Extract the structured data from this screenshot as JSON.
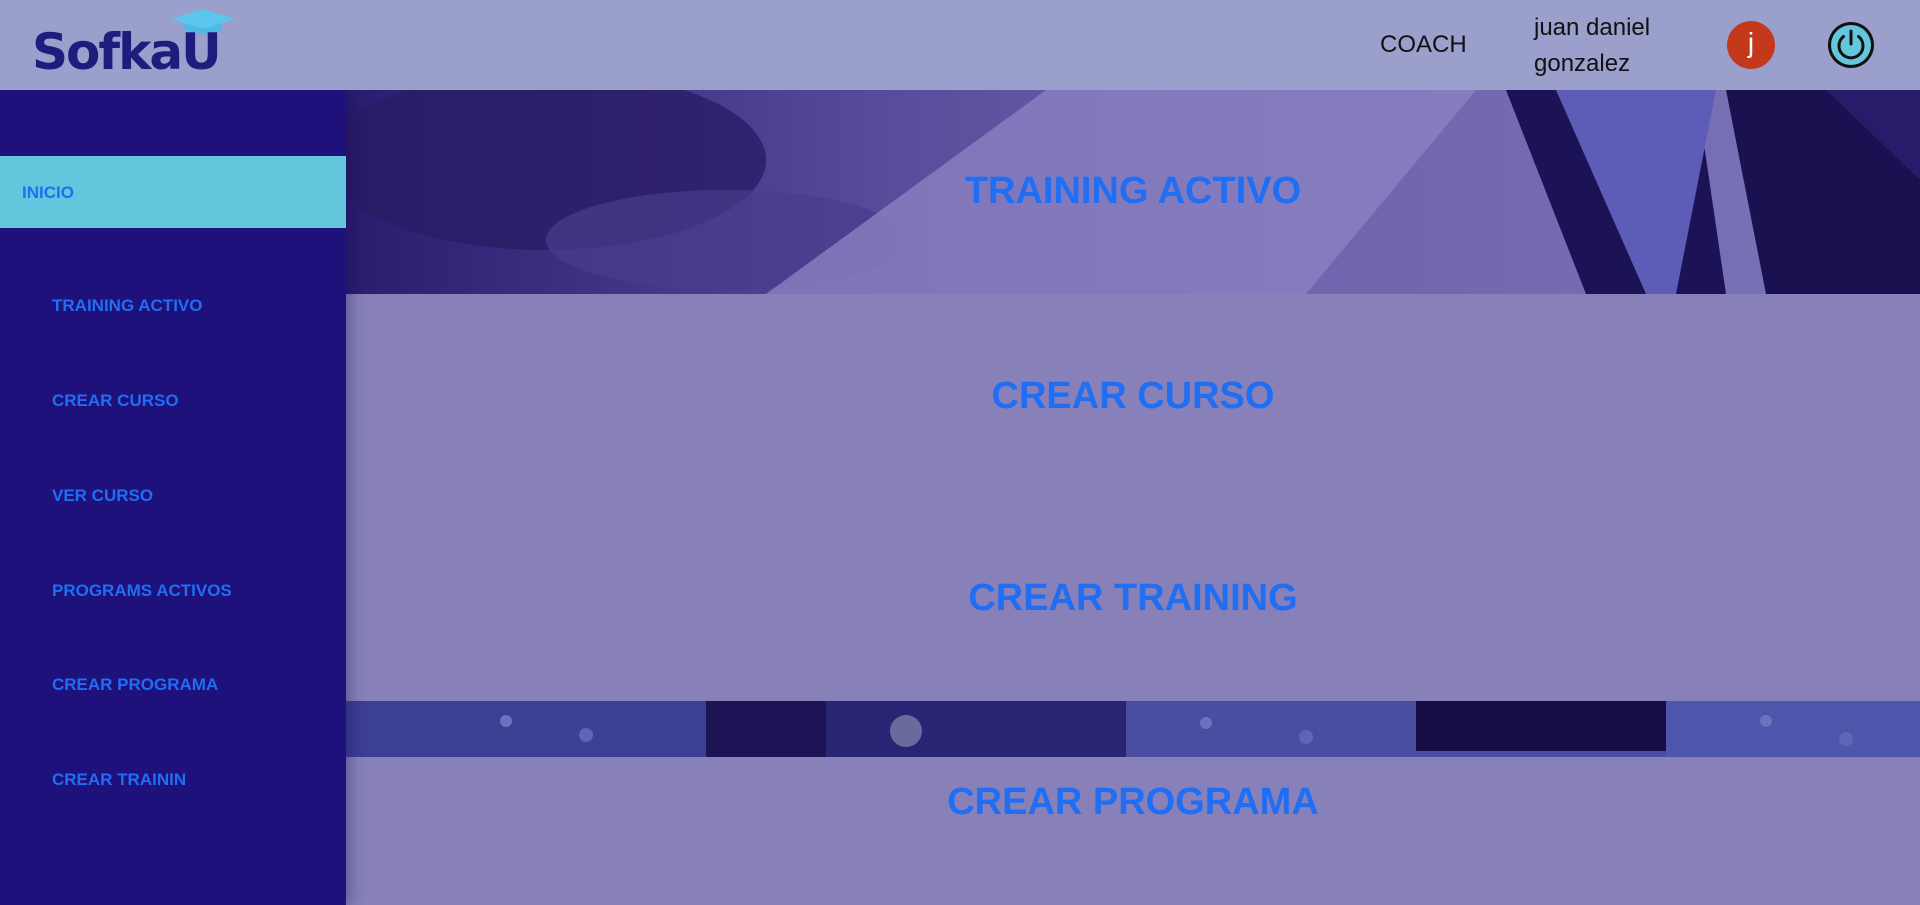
{
  "header": {
    "logo_text": "SofkaU",
    "role": "COACH",
    "user_name": "juan daniel gonzalez",
    "avatar_initial": "j"
  },
  "sidebar": {
    "active_item": "INICIO",
    "items": [
      {
        "label": "TRAINING ACTIVO"
      },
      {
        "label": "CREAR CURSO"
      },
      {
        "label": "VER CURSO"
      },
      {
        "label": "PROGRAMS ACTIVOS"
      },
      {
        "label": "CREAR PROGRAMA"
      },
      {
        "label": "CREAR TRAININ"
      }
    ]
  },
  "main": {
    "panels": [
      {
        "title": "TRAINING ACTIVO"
      },
      {
        "title": "CREAR CURSO"
      },
      {
        "title": "CREAR TRAINING"
      },
      {
        "title": "CREAR PROGRAMA"
      }
    ]
  },
  "icons": {
    "logo": "graduation-cap-icon",
    "power": "power-icon"
  },
  "colors": {
    "header_bg": "#9a9fcc",
    "sidebar_bg": "#1e117c",
    "active_item_bg": "#63c6dc",
    "link_blue": "#1f6ef3",
    "avatar_bg": "#c4381b",
    "main_bg": "#8780b9"
  }
}
